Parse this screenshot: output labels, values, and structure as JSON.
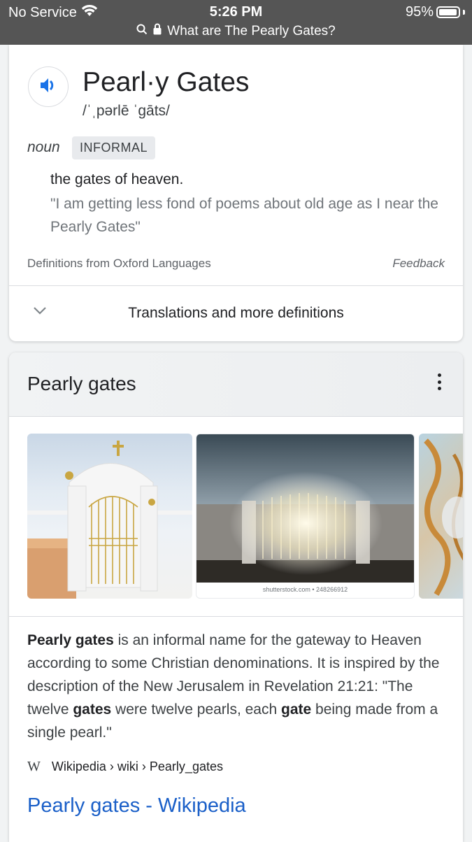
{
  "status_bar": {
    "carrier": "No Service",
    "time": "5:26 PM",
    "battery_percent": "95%",
    "battery_level": 0.95,
    "url_text": "What are The Pearly Gates?"
  },
  "dictionary": {
    "word": "Pearl·y Gates",
    "phonetic": "/ˈˌpərlē ˈgāts/",
    "part_of_speech": "noun",
    "register_badge": "INFORMAL",
    "definition": "the gates of heaven.",
    "example": "\"I am getting less fond of poems about old age as I near the Pearly Gates\"",
    "source": "Definitions from Oxford Languages",
    "feedback": "Feedback",
    "more_label": "Translations and more definitions"
  },
  "knowledge_panel": {
    "title": "Pearly gates",
    "images": [
      {
        "alt": "Pearly gates illustration with gold cross",
        "caption": ""
      },
      {
        "alt": "Glowing gates with light rays",
        "caption": "shutterstock.com • 248266912"
      },
      {
        "alt": "Ornate gold ceiling artwork",
        "caption": ""
      }
    ],
    "description": {
      "b1": "Pearly gates",
      "t1": " is an informal name for the gateway to Heaven according to some Christian denominations. It is inspired by the description of the New Jerusalem in Revelation 21:21: \"The twelve ",
      "b2": "gates",
      "t2": " were twelve pearls, each ",
      "b3": "gate",
      "t3": " being made from a single pearl.\""
    },
    "citation": {
      "logo": "W",
      "path": "Wikipedia › wiki › Pearly_gates"
    },
    "link_title": "Pearly gates - Wikipedia"
  },
  "colors": {
    "accent_blue": "#1a73e8",
    "link_blue": "#1a5fc8",
    "status_bar_bg": "#555555"
  }
}
